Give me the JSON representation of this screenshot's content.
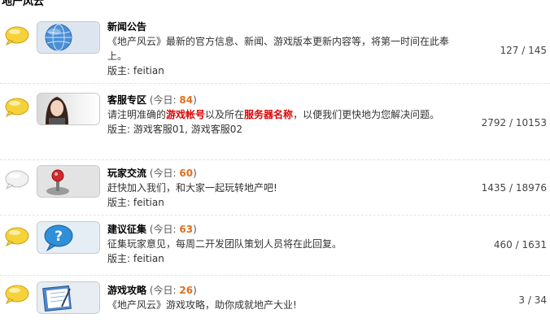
{
  "section": {
    "title": "地产风云"
  },
  "forums": [
    {
      "name": "新闻公告",
      "description": "《地产风云》最新的官方信息、新闻、游戏版本更新内容等，将第一时间在此奉上。",
      "moderator_label": "版主:",
      "moderators": "feitian",
      "stats": "127 / 145",
      "icon": "globe-icon"
    },
    {
      "name": "客服专区",
      "today_label": "(今日:",
      "today_count": "84",
      "today_close": ")",
      "description_parts": [
        "请注明准确的",
        "游戏帐号",
        "以及所在",
        "服务器名称",
        "，以便我们更快地为您解决问题。"
      ],
      "moderator_label": "版主:",
      "moderators": "游戏客服01, 游戏客服02",
      "stats": "2792 / 10153",
      "icon": "support-girl-icon"
    },
    {
      "name": "玩家交流",
      "today_label": "(今日:",
      "today_count": "60",
      "today_close": ")",
      "description": "赶快加入我们，和大家一起玩转地产吧!",
      "moderator_label": "版主:",
      "moderators": "feitian",
      "stats": "1435 / 18976",
      "icon": "joystick-icon"
    },
    {
      "name": "建议征集",
      "today_label": "(今日:",
      "today_count": "63",
      "today_close": ")",
      "description": "征集玩家意见，每周二开发团队策划人员将在此回复。",
      "moderator_label": "版主:",
      "moderators": "feitian",
      "stats": "460 / 1631",
      "icon": "speech-bubble-icon"
    },
    {
      "name": "游戏攻略",
      "today_label": "(今日:",
      "today_count": "26",
      "today_close": ")",
      "description": "《地产风云》游戏攻略，助你成就地产大业!",
      "stats": "3 / 34",
      "icon": "notebook-icon"
    }
  ],
  "colors": {
    "new_bubble": "#f6d23a",
    "old_bubble": "#e4e4e4",
    "today_count": "#e0701f",
    "highlight": "#e00000"
  }
}
